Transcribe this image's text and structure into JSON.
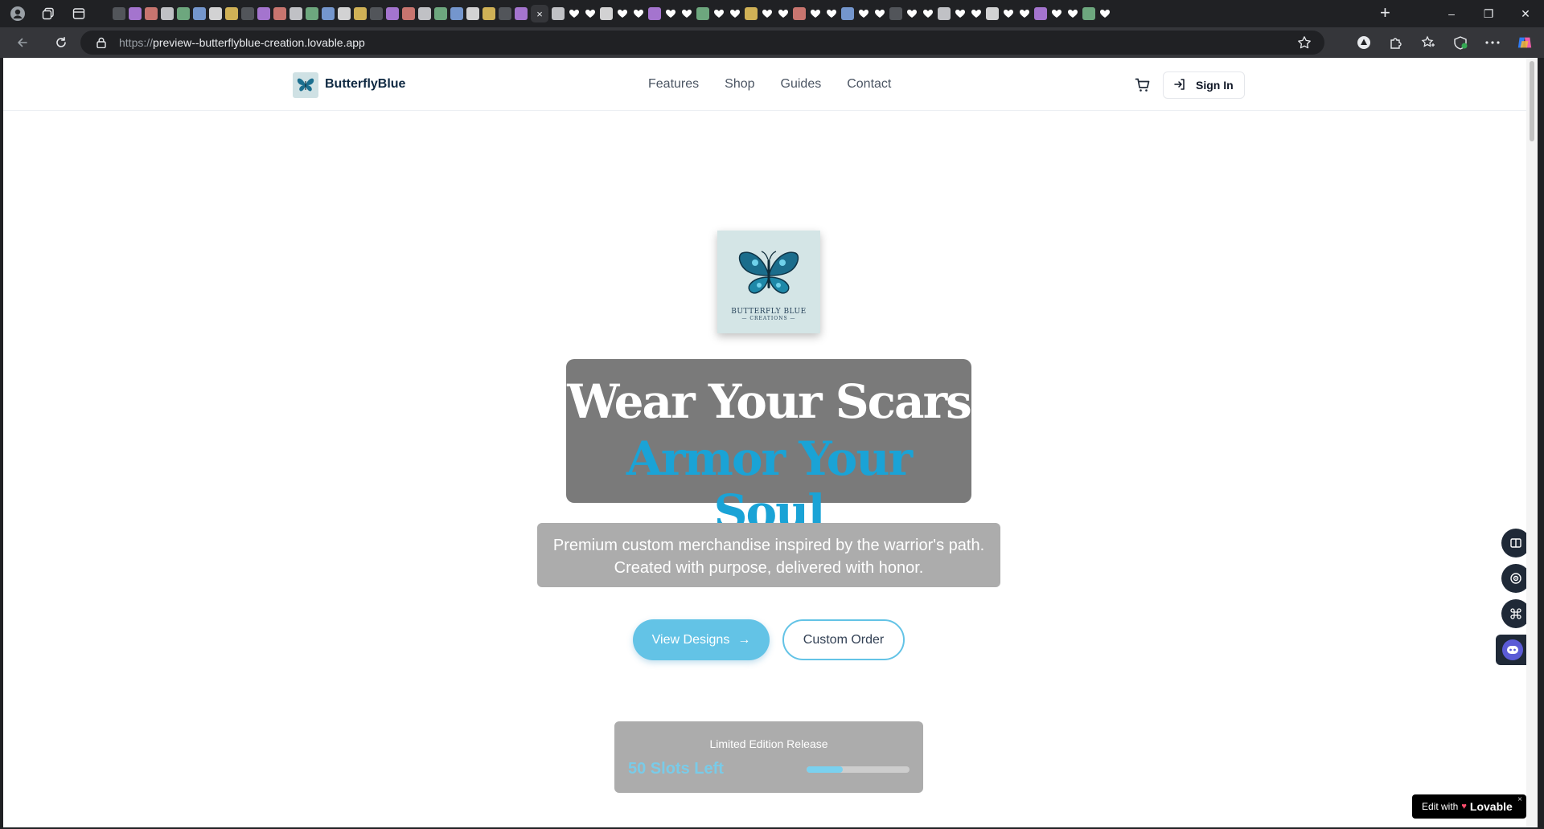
{
  "browser": {
    "url_scheme": "https://",
    "url_host": "preview--butterflyblue-creation.lovable.app",
    "active_tab_close": "×",
    "new_tab": "+",
    "win_minimize": "–",
    "win_maximize": "❐",
    "win_close": "✕"
  },
  "header": {
    "brand": "ButterflyBlue",
    "nav": [
      "Features",
      "Shop",
      "Guides",
      "Contact"
    ],
    "signin_label": "Sign In"
  },
  "hero": {
    "logo_text_line1": "BUTTERFLY BLUE",
    "logo_text_line2": "— CREATIONS —",
    "headline_line1": "Wear Your Scars",
    "headline_line2": "Armor Your Soul",
    "subtitle_line1": "Premium custom merchandise inspired by the warrior's path.",
    "subtitle_line2": "Created with purpose, delivered with honor.",
    "primary_cta": "View Designs",
    "primary_cta_arrow": "→",
    "secondary_cta": "Custom Order"
  },
  "limited": {
    "label": "Limited Edition Release",
    "slots_text": "50 Slots Left",
    "progress_fraction": 0.35
  },
  "lovable_badge": {
    "prefix": "Edit with",
    "brand": "Lovable",
    "close": "×"
  },
  "colors": {
    "accent": "#1aa3d6",
    "button": "#63c3e6",
    "brand_text": "#0f2942"
  },
  "icons": {
    "cart": "cart-icon",
    "signin": "sign-in-icon",
    "arrow": "arrow-right-icon",
    "lock": "lock-icon",
    "star": "star-icon"
  }
}
